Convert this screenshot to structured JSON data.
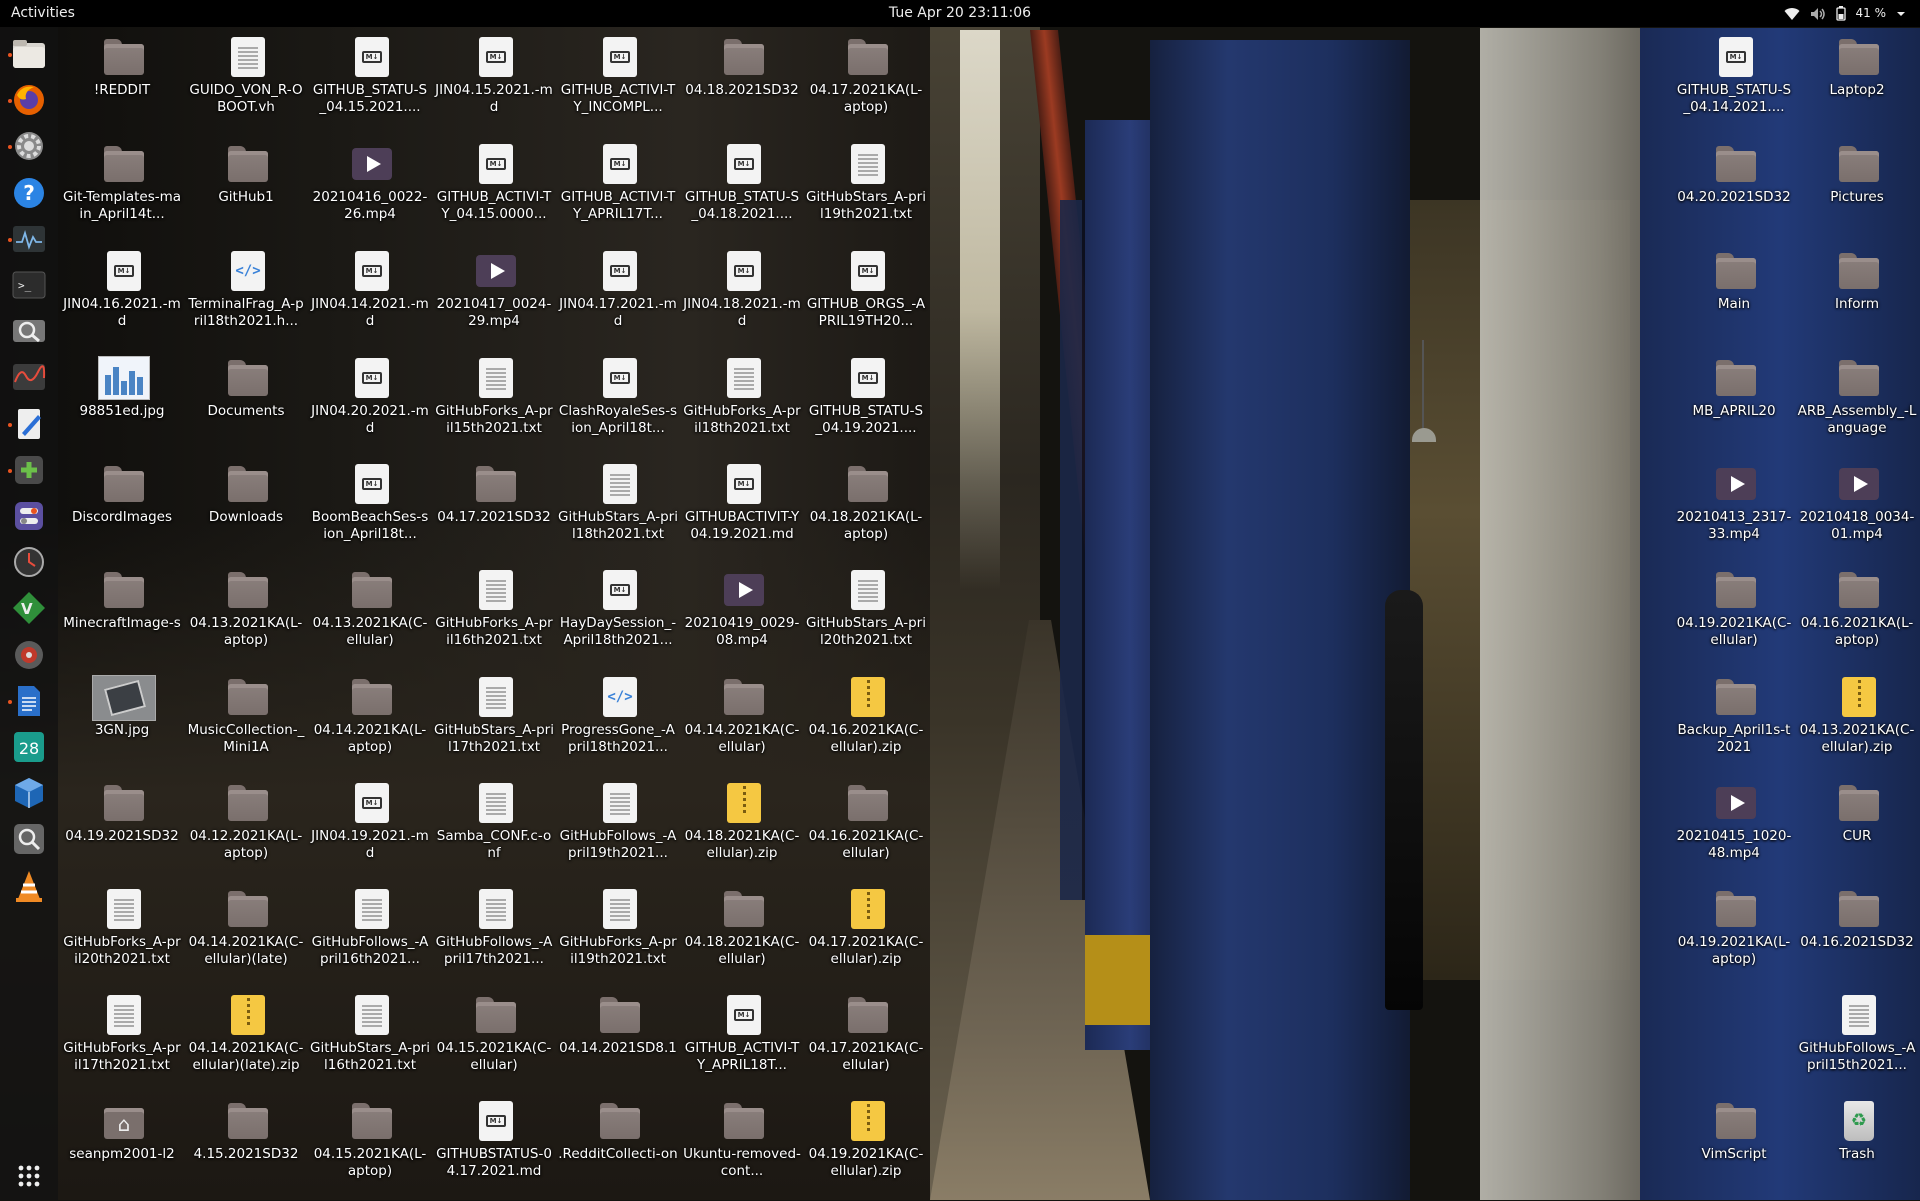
{
  "topbar": {
    "activities": "Activities",
    "clock": "Tue Apr 20  23:11:06",
    "battery": "41 %",
    "status_icons": [
      "wifi-icon",
      "volume-icon",
      "battery-icon",
      "system-menu-caret-icon"
    ]
  },
  "dock": {
    "items": [
      {
        "name": "files",
        "icon": "files-icon",
        "running": true
      },
      {
        "name": "firefox",
        "icon": "firefox-icon",
        "running": true
      },
      {
        "name": "settings",
        "icon": "gear-icon",
        "running": true
      },
      {
        "name": "help",
        "icon": "help-icon",
        "running": false
      },
      {
        "name": "system-monitor",
        "icon": "system-monitor-icon",
        "running": true
      },
      {
        "name": "terminal",
        "icon": "terminal-icon",
        "running": false
      },
      {
        "name": "screenshot",
        "icon": "screenshot-icon",
        "running": false
      },
      {
        "name": "power-statistics",
        "icon": "power-statistics-icon",
        "running": false
      },
      {
        "name": "text-editor",
        "icon": "text-editor-icon",
        "running": true
      },
      {
        "name": "add-app",
        "icon": "plus-icon",
        "running": true
      },
      {
        "name": "tweaks",
        "icon": "tweaks-icon",
        "running": false
      },
      {
        "name": "clock",
        "icon": "clock-icon",
        "running": false
      },
      {
        "name": "vim",
        "icon": "vim-icon",
        "running": false
      },
      {
        "name": "disk-utility",
        "icon": "disk-icon",
        "running": false
      },
      {
        "name": "libreoffice-writer",
        "icon": "writer-icon",
        "running": true
      },
      {
        "name": "calendar",
        "icon": "calendar-icon",
        "running": false,
        "text": "28"
      },
      {
        "name": "virtualbox",
        "icon": "virtualbox-icon",
        "running": false
      },
      {
        "name": "search",
        "icon": "search-icon",
        "running": false
      },
      {
        "name": "vlc",
        "icon": "vlc-icon",
        "running": false
      }
    ],
    "apps_grid": "show-applications-icon"
  },
  "desktop": {
    "colors": {
      "folder": "#7a6f6c",
      "zip": "#f5c842",
      "video": "#4d3e57",
      "accent": "#e95420"
    },
    "icons": [
      {
        "label": "!REDDIT",
        "type": "folder",
        "col": 0,
        "row": 0
      },
      {
        "label": "GUIDO_VON_R-OBOOT.vh",
        "type": "doc",
        "col": 1,
        "row": 0
      },
      {
        "label": "GITHUB_STATU-S_04.15.2021....",
        "type": "md",
        "col": 2,
        "row": 0
      },
      {
        "label": "JIN04.15.2021.-md",
        "type": "md",
        "col": 3,
        "row": 0
      },
      {
        "label": "GITHUB_ACTIVI-TY_INCOMPL...",
        "type": "md",
        "col": 4,
        "row": 0
      },
      {
        "label": "04.18.2021SD32",
        "type": "folder",
        "col": 5,
        "row": 0
      },
      {
        "label": "04.17.2021KA(L-aptop)",
        "type": "folder",
        "col": 6,
        "row": 0
      },
      {
        "label": "Git-Templates-main_April14t...",
        "type": "folder",
        "col": 0,
        "row": 1
      },
      {
        "label": "GitHub1",
        "type": "folder",
        "col": 1,
        "row": 1
      },
      {
        "label": "20210416_0022-26.mp4",
        "type": "video",
        "col": 2,
        "row": 1
      },
      {
        "label": "GITHUB_ACTIVI-TY_04.15.0000...",
        "type": "md",
        "col": 3,
        "row": 1
      },
      {
        "label": "GITHUB_ACTIVI-TY_APRIL17T...",
        "type": "md",
        "col": 4,
        "row": 1
      },
      {
        "label": "GITHUB_STATU-S_04.18.2021....",
        "type": "md",
        "col": 5,
        "row": 1
      },
      {
        "label": "GitHubStars_A-pril19th2021.txt",
        "type": "doc",
        "col": 6,
        "row": 1
      },
      {
        "label": "JIN04.16.2021.-md",
        "type": "md",
        "col": 0,
        "row": 2
      },
      {
        "label": "TerminalFrag_A-pril18th2021.h...",
        "type": "html",
        "col": 1,
        "row": 2
      },
      {
        "label": "JIN04.14.2021.-md",
        "type": "md",
        "col": 2,
        "row": 2
      },
      {
        "label": "20210417_0024-29.mp4",
        "type": "video",
        "col": 3,
        "row": 2
      },
      {
        "label": "JIN04.17.2021.-md",
        "type": "md",
        "col": 4,
        "row": 2
      },
      {
        "label": "JIN04.18.2021.-md",
        "type": "md",
        "col": 5,
        "row": 2
      },
      {
        "label": "GITHUB_ORGS_-APRIL19TH20...",
        "type": "md",
        "col": 6,
        "row": 2
      },
      {
        "label": "98851ed.jpg",
        "type": "img1",
        "col": 0,
        "row": 3
      },
      {
        "label": "Documents",
        "type": "folder",
        "col": 1,
        "row": 3
      },
      {
        "label": "JIN04.20.2021.-md",
        "type": "md",
        "col": 2,
        "row": 3
      },
      {
        "label": "GitHubForks_A-pril15th2021.txt",
        "type": "doc",
        "col": 3,
        "row": 3
      },
      {
        "label": "ClashRoyaleSes-sion_April18t...",
        "type": "md",
        "col": 4,
        "row": 3
      },
      {
        "label": "GitHubForks_A-pril18th2021.txt",
        "type": "doc",
        "col": 5,
        "row": 3
      },
      {
        "label": "GITHUB_STATU-S_04.19.2021....",
        "type": "md",
        "col": 6,
        "row": 3
      },
      {
        "label": "DiscordImages",
        "type": "folder",
        "col": 0,
        "row": 4
      },
      {
        "label": "Downloads",
        "type": "folder",
        "col": 1,
        "row": 4
      },
      {
        "label": "BoomBeachSes-sion_April18t...",
        "type": "md",
        "col": 2,
        "row": 4
      },
      {
        "label": "04.17.2021SD32",
        "type": "folder",
        "col": 3,
        "row": 4
      },
      {
        "label": "GitHubStars_A-pril18th2021.txt",
        "type": "doc",
        "col": 4,
        "row": 4
      },
      {
        "label": "GITHUBACTIVIT-Y04.19.2021.md",
        "type": "md",
        "col": 5,
        "row": 4
      },
      {
        "label": "04.18.2021KA(L-aptop)",
        "type": "folder",
        "col": 6,
        "row": 4
      },
      {
        "label": "MinecraftImage-s",
        "type": "folder",
        "col": 0,
        "row": 5
      },
      {
        "label": "04.13.2021KA(L-aptop)",
        "type": "folder",
        "col": 1,
        "row": 5
      },
      {
        "label": "04.13.2021KA(C-ellular)",
        "type": "folder",
        "col": 2,
        "row": 5
      },
      {
        "label": "GitHubForks_A-pril16th2021.txt",
        "type": "doc",
        "col": 3,
        "row": 5
      },
      {
        "label": "HayDaySession_-April18th2021...",
        "type": "md",
        "col": 4,
        "row": 5
      },
      {
        "label": "20210419_0029-08.mp4",
        "type": "video",
        "col": 5,
        "row": 5
      },
      {
        "label": "GitHubStars_A-pril20th2021.txt",
        "type": "doc",
        "col": 6,
        "row": 5
      },
      {
        "label": "3GN.jpg",
        "type": "img2",
        "col": 0,
        "row": 6
      },
      {
        "label": "MusicCollection-_Mini1A",
        "type": "folder",
        "col": 1,
        "row": 6
      },
      {
        "label": "04.14.2021KA(L-aptop)",
        "type": "folder",
        "col": 2,
        "row": 6
      },
      {
        "label": "GitHubStars_A-pril17th2021.txt",
        "type": "doc",
        "col": 3,
        "row": 6
      },
      {
        "label": "ProgressGone_-April18th2021...",
        "type": "html",
        "col": 4,
        "row": 6
      },
      {
        "label": "04.14.2021KA(C-ellular)",
        "type": "folder",
        "col": 5,
        "row": 6
      },
      {
        "label": "04.16.2021KA(C-ellular).zip",
        "type": "zip",
        "col": 6,
        "row": 6
      },
      {
        "label": "04.19.2021SD32",
        "type": "folder",
        "col": 0,
        "row": 7
      },
      {
        "label": "04.12.2021KA(L-aptop)",
        "type": "folder",
        "col": 1,
        "row": 7
      },
      {
        "label": "JIN04.19.2021.-md",
        "type": "md",
        "col": 2,
        "row": 7
      },
      {
        "label": "Samba_CONF.c-onf",
        "type": "doc",
        "col": 3,
        "row": 7
      },
      {
        "label": "GitHubFollows_-April19th2021...",
        "type": "doc",
        "col": 4,
        "row": 7
      },
      {
        "label": "04.18.2021KA(C-ellular).zip",
        "type": "zip",
        "col": 5,
        "row": 7
      },
      {
        "label": "04.16.2021KA(C-ellular)",
        "type": "folder",
        "col": 6,
        "row": 7
      },
      {
        "label": "GitHubForks_A-pril20th2021.txt",
        "type": "doc",
        "col": 0,
        "row": 8
      },
      {
        "label": "04.14.2021KA(C-ellular)(late)",
        "type": "folder",
        "col": 1,
        "row": 8
      },
      {
        "label": "GitHubFollows_-April16th2021...",
        "type": "doc",
        "col": 2,
        "row": 8
      },
      {
        "label": "GitHubFollows_-April17th2021...",
        "type": "doc",
        "col": 3,
        "row": 8
      },
      {
        "label": "GitHubForks_A-pril19th2021.txt",
        "type": "doc",
        "col": 4,
        "row": 8
      },
      {
        "label": "04.18.2021KA(C-ellular)",
        "type": "folder",
        "col": 5,
        "row": 8
      },
      {
        "label": "04.17.2021KA(C-ellular).zip",
        "type": "zip",
        "col": 6,
        "row": 8
      },
      {
        "label": "GitHubForks_A-pril17th2021.txt",
        "type": "doc",
        "col": 0,
        "row": 9
      },
      {
        "label": "04.14.2021KA(C-ellular)(late).zip",
        "type": "zip",
        "col": 1,
        "row": 9
      },
      {
        "label": "GitHubStars_A-pril16th2021.txt",
        "type": "doc",
        "col": 2,
        "row": 9
      },
      {
        "label": "04.15.2021KA(C-ellular)",
        "type": "folder",
        "col": 3,
        "row": 9
      },
      {
        "label": "04.14.2021SD8.1",
        "type": "folder",
        "col": 4,
        "row": 9
      },
      {
        "label": "GITHUB_ACTIVI-TY_APRIL18T...",
        "type": "md",
        "col": 5,
        "row": 9
      },
      {
        "label": "04.17.2021KA(C-ellular)",
        "type": "folder",
        "col": 6,
        "row": 9
      },
      {
        "label": "seanpm2001-l2",
        "type": "home",
        "col": 0,
        "row": 10
      },
      {
        "label": "4.15.2021SD32",
        "type": "folder",
        "col": 1,
        "row": 10
      },
      {
        "label": "04.15.2021KA(L-aptop)",
        "type": "folder",
        "col": 2,
        "row": 10
      },
      {
        "label": "GITHUBSTATUS-04.17.2021.md",
        "type": "md",
        "col": 3,
        "row": 10
      },
      {
        "label": ".RedditCollecti-on",
        "type": "folder",
        "col": 4,
        "row": 10
      },
      {
        "label": "Ukuntu-removed-cont...",
        "type": "folder",
        "col": 5,
        "row": 10
      },
      {
        "label": "04.19.2021KA(C-ellular).zip",
        "type": "zip",
        "col": 6,
        "row": 10
      },
      {
        "label": "GITHUB_STATU-S_04.14.2021....",
        "type": "md",
        "col": 7,
        "row": 0
      },
      {
        "label": "Laptop2",
        "type": "folder",
        "col": 8,
        "row": 0
      },
      {
        "label": "04.20.2021SD32",
        "type": "folder",
        "col": 7,
        "row": 1
      },
      {
        "label": "Pictures",
        "type": "folder",
        "col": 8,
        "row": 1
      },
      {
        "label": "Main",
        "type": "folder",
        "col": 7,
        "row": 2
      },
      {
        "label": "Inform",
        "type": "folder",
        "col": 8,
        "row": 2
      },
      {
        "label": "MB_APRIL20",
        "type": "folder",
        "col": 7,
        "row": 3
      },
      {
        "label": "ARB_Assembly_-Language",
        "type": "folder",
        "col": 8,
        "row": 3
      },
      {
        "label": "20210413_2317-33.mp4",
        "type": "video",
        "col": 7,
        "row": 4
      },
      {
        "label": "20210418_0034-01.mp4",
        "type": "video",
        "col": 8,
        "row": 4
      },
      {
        "label": "04.19.2021KA(C-ellular)",
        "type": "folder",
        "col": 7,
        "row": 5
      },
      {
        "label": "04.16.2021KA(L-aptop)",
        "type": "folder",
        "col": 8,
        "row": 5
      },
      {
        "label": "Backup_April1s-t2021",
        "type": "folder",
        "col": 7,
        "row": 6
      },
      {
        "label": "04.13.2021KA(C-ellular).zip",
        "type": "zip",
        "col": 8,
        "row": 6
      },
      {
        "label": "20210415_1020-48.mp4",
        "type": "video",
        "col": 7,
        "row": 7
      },
      {
        "label": "CUR",
        "type": "folder",
        "col": 8,
        "row": 7
      },
      {
        "label": "04.19.2021KA(L-aptop)",
        "type": "folder",
        "col": 7,
        "row": 8
      },
      {
        "label": "04.16.2021SD32",
        "type": "folder",
        "col": 8,
        "row": 8
      },
      {
        "label": "GitHubFollows_-April15th2021...",
        "type": "doc",
        "col": 8,
        "row": 9
      },
      {
        "label": "VimScript",
        "type": "folder",
        "col": 7,
        "row": 10
      },
      {
        "label": "Trash",
        "type": "trash",
        "col": 8,
        "row": 10
      }
    ]
  }
}
